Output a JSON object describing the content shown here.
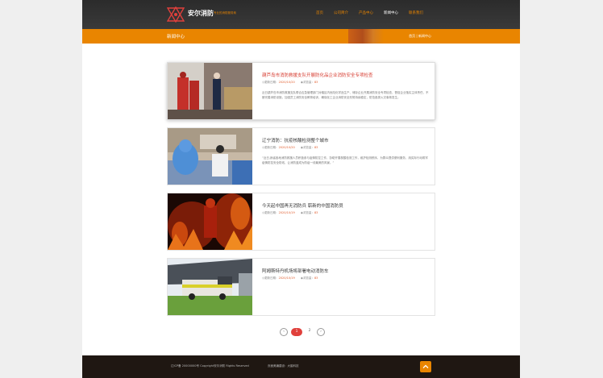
{
  "header": {
    "logo_text": "安尔消防",
    "logo_sub": "专业的消防服务商",
    "nav": [
      "首页",
      "公司简介",
      "产品中心",
      "新闻中心",
      "联系我们"
    ],
    "active_index": 3
  },
  "banner": {
    "title": "新闻中心",
    "breadcrumb": [
      "首页",
      "新闻中心"
    ]
  },
  "news": [
    {
      "title": "葫芦岛市消防救援支队开展防化品企业消防安全专项检查",
      "date_label": "更新日期：",
      "date": "2020/10/20",
      "views_label": "浏览量：",
      "views": "83",
      "desc": "近日葫芦岛市消防救援支队联合应急管理部门对辖区内危险化学品生产、储存企业开展消防安全专项检查，督促企业落实主体责任，不断完善消防设施，加强员工消防安全教育培训，确保化工企业消防安全形势持续稳定，防范各类火灾事故发生。"
    },
    {
      "title": "辽宁消防：抗疫核酸检测整个城市",
      "date_label": "更新日期：",
      "date": "2020/10/20",
      "views_label": "浏览量：",
      "views": "83",
      "desc": "“近日,我省各地消防救援人员积极参与疫情防控工作，协助开展核酸检测工作，维护检测秩序，为群众提供便利服务，用实际行动筑牢疫情防控安全防线，让消防蓝成为防疫一线最美的风景。”"
    },
    {
      "title": "今天起中国再无消防兵 崭新的中国消防员",
      "date_label": "更新日期：",
      "date": "2020/10/19",
      "views_label": "浏览量：",
      "views": "83",
      "desc": ""
    },
    {
      "title": "阿姆斯特丹机场将部署电动消防车",
      "date_label": "更新日期：",
      "date": "2020/10/19",
      "views_label": "浏览量：",
      "views": "83",
      "desc": ""
    }
  ],
  "pager": {
    "prev": "‹",
    "pages": [
      "1",
      "2"
    ],
    "next": "›"
  },
  "footer": {
    "copyright": "辽ICP备 20000000号  Copyright安尔消防 Rights Reserved",
    "support": "页面美编建设：大脑科技"
  },
  "colors": {
    "accent": "#e98500",
    "header_bg": "#2b2b2b",
    "footer_bg": "#1f1712",
    "title_red": "#d63b2f"
  }
}
